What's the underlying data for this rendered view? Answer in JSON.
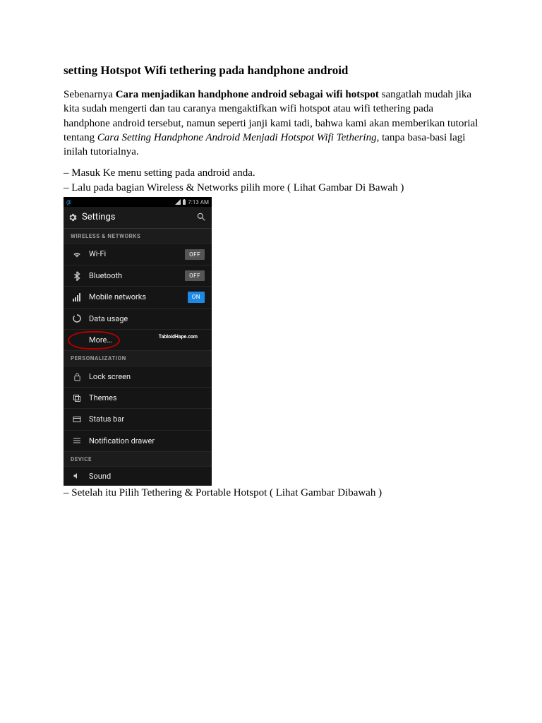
{
  "doc": {
    "title": "setting Hotspot Wifi tethering pada handphone android",
    "intro_pre": "Sebenarnya ",
    "intro_bold": "Cara menjadikan handphone android sebagai wifi hotspot",
    "intro_mid": " sangatlah mudah jika kita sudah mengerti dan tau caranya mengaktifkan wifi hotspot atau wifi tethering pada handphone android tersebut, namun seperti janji kami tadi, bahwa kami akan memberikan tutorial tentang ",
    "intro_ital": "Cara Setting Handphone Android Menjadi Hotspot Wifi Tethering",
    "intro_post": ", tanpa basa-basi lagi inilah tutorialnya.",
    "step1": "– Masuk Ke menu setting pada android anda.",
    "step2": "– Lalu pada bagian Wireless & Networks pilih more ( Lihat Gambar Di Bawah )",
    "step3": "– Setelah itu Pilih Tethering & Portable Hotspot ( Lihat Gambar Dibawah )"
  },
  "phone": {
    "status_left": "@",
    "status_time": "7:13 AM",
    "titlebar": "Settings",
    "section_wireless": "WIRELESS & NETWORKS",
    "section_personal": "PERSONALIZATION",
    "section_device": "DEVICE",
    "rows": {
      "wifi": "Wi-Fi",
      "bluetooth": "Bluetooth",
      "mobile": "Mobile networks",
      "data": "Data usage",
      "more": "More…",
      "lock": "Lock screen",
      "themes": "Themes",
      "statusbar": "Status bar",
      "notif": "Notification drawer",
      "sound": "Sound"
    },
    "toggles": {
      "off": "OFF",
      "on": "ON"
    },
    "watermark": "TabloidHape.com"
  }
}
